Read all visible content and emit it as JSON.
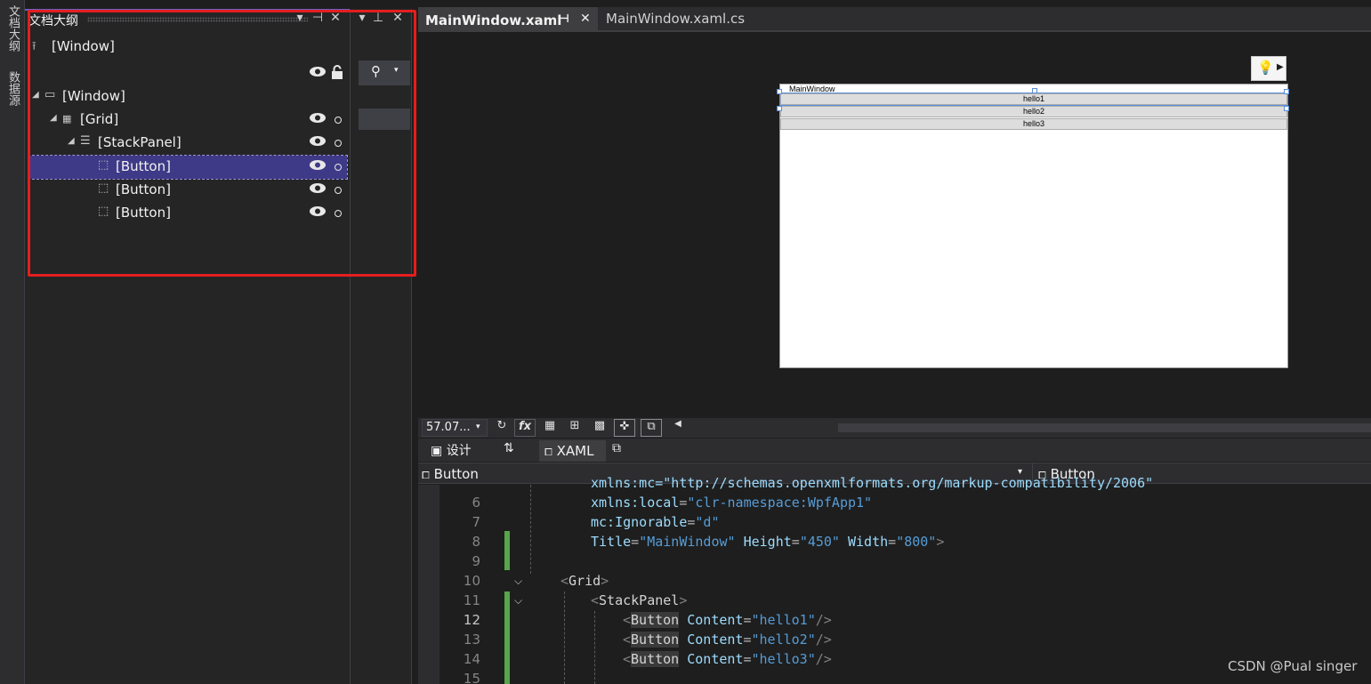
{
  "left_strip": {
    "tab1": "文档大纲",
    "tab2": "数据源"
  },
  "outline": {
    "title": "文档大纲",
    "root": "[Window]",
    "tree": [
      {
        "label": "[Window]",
        "icon": "window-icon",
        "level": 0
      },
      {
        "label": "[Grid]",
        "icon": "grid-icon",
        "level": 1
      },
      {
        "label": "[StackPanel]",
        "icon": "stackpanel-icon",
        "level": 2
      },
      {
        "label": "[Button]",
        "icon": "button-icon",
        "level": 3,
        "selected": true
      },
      {
        "label": "[Button]",
        "icon": "button-icon",
        "level": 3
      },
      {
        "label": "[Button]",
        "icon": "button-icon",
        "level": 3
      }
    ]
  },
  "tabs": {
    "active": "MainWindow.xaml",
    "inactive": "MainWindow.xaml.cs"
  },
  "designer": {
    "window_title": "MainWindow",
    "buttons": [
      "hello1",
      "hello2",
      "hello3"
    ]
  },
  "toolbar": {
    "zoom": "57.07..."
  },
  "views": {
    "design": "设计",
    "xaml": "XAML"
  },
  "navbar": {
    "left": "Button",
    "right": "Button"
  },
  "code": {
    "top_partial": "xmlns:mc=\"http://schemas.openxmlformats.org/markup-compatibility/2006\"",
    "lines": [
      {
        "n": "6",
        "attr": "xmlns:local",
        "val": "\"clr-namespace:WpfApp1\""
      },
      {
        "n": "7",
        "attr": "mc:Ignorable",
        "val": "\"d\""
      },
      {
        "n": "8",
        "t1": "Title",
        "v1": "\"MainWindow\"",
        "t2": "Height",
        "v2": "\"450\"",
        "t3": "Width",
        "v3": "\"800\""
      },
      {
        "n": "9"
      },
      {
        "n": "10",
        "tag": "Grid"
      },
      {
        "n": "11",
        "tag": "StackPanel"
      },
      {
        "n": "12",
        "btn": "Button",
        "attr": "Content",
        "val": "\"hello1\""
      },
      {
        "n": "13",
        "btn": "Button",
        "attr": "Content",
        "val": "\"hello2\""
      },
      {
        "n": "14",
        "btn": "Button",
        "attr": "Content",
        "val": "\"hello3\""
      },
      {
        "n": "15"
      }
    ]
  },
  "watermark": "CSDN @Pual singer",
  "colors": {
    "highlight": "#e51e1e",
    "selection": "#3f3a87",
    "accent": "#6b5fc7"
  }
}
